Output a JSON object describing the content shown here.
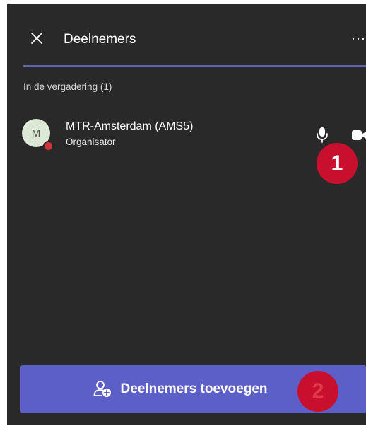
{
  "header": {
    "title": "Deelnemers",
    "close_icon": "close-icon",
    "more_label": "···",
    "accent_color": "#6264a7"
  },
  "section": {
    "label": "In de vergadering (1)"
  },
  "participants": [
    {
      "initial": "M",
      "name": "MTR-Amsterdam (AMS5)",
      "role": "Organisator",
      "presence_color": "#d13438",
      "icons": [
        "microphone-icon",
        "camera-icon"
      ]
    }
  ],
  "annotations": [
    {
      "number": "1"
    },
    {
      "number": "2"
    }
  ],
  "add_button": {
    "label": "Deelnemers toevoegen",
    "icon": "add-person-icon",
    "color": "#5b5fc7"
  }
}
